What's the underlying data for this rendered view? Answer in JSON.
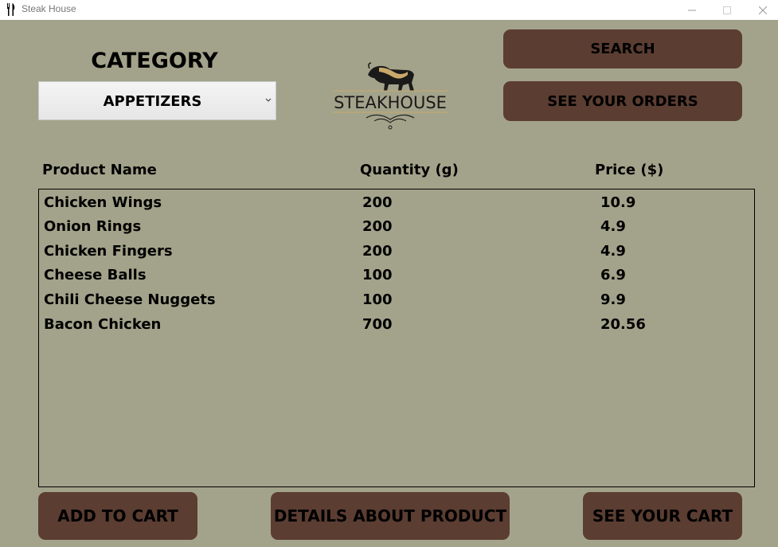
{
  "window": {
    "title": "Steak House",
    "icon": "fork-knife-icon"
  },
  "category": {
    "title": "CATEGORY",
    "selected": "APPETIZERS"
  },
  "logo": {
    "text": "STEAKHOUSE",
    "icon": "bull-icon",
    "colors": {
      "gold": "#c9a86b",
      "dark": "#1a1a1a"
    }
  },
  "buttons": {
    "search": "SEARCH",
    "orders": "SEE YOUR ORDERS",
    "add_to_cart": "ADD TO CART",
    "details": "DETAILS ABOUT PRODUCT",
    "see_cart": "SEE YOUR CART"
  },
  "table": {
    "headers": {
      "name": "Product Name",
      "quantity": "Quantity (g)",
      "price": "Price ($)"
    },
    "rows": [
      {
        "name": "Chicken Wings",
        "quantity": "200",
        "price": "10.9"
      },
      {
        "name": "Onion Rings",
        "quantity": "200",
        "price": "4.9"
      },
      {
        "name": "Chicken Fingers",
        "quantity": "200",
        "price": "4.9"
      },
      {
        "name": "Cheese Balls",
        "quantity": "100",
        "price": "6.9"
      },
      {
        "name": "Chili Cheese Nuggets",
        "quantity": "100",
        "price": "9.9"
      },
      {
        "name": "Bacon Chicken",
        "quantity": "700",
        "price": "20.56"
      }
    ]
  },
  "colors": {
    "background": "#a3a38b",
    "button": "#5b3d32"
  }
}
